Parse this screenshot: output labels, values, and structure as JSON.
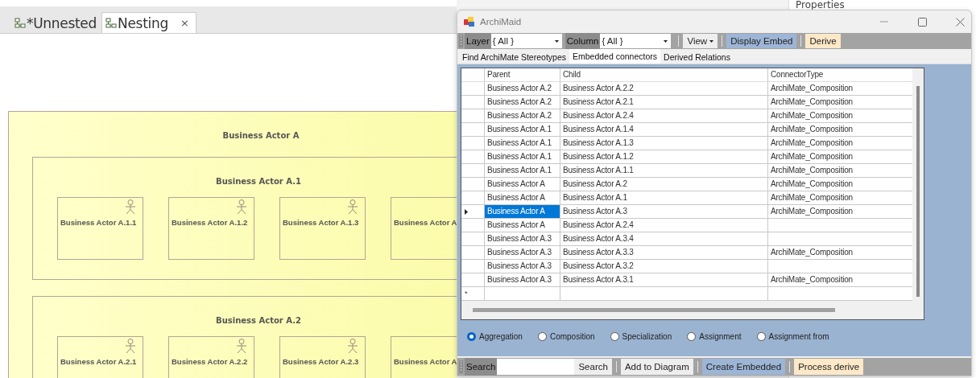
{
  "editor": {
    "tabs": [
      {
        "label": "*Unnested",
        "selected": false
      },
      {
        "label": "Nesting",
        "selected": true,
        "close": "×"
      }
    ],
    "diagram": {
      "title": "Business Actor A",
      "groups": [
        {
          "title": "Business Actor A.1",
          "actors": [
            "Business Actor A.1.1",
            "Business Actor A.1.2",
            "Business Actor A.1.3",
            "Business Actor A"
          ]
        },
        {
          "title": "Business Actor A.2",
          "actors": [
            "Business Actor A.2.1",
            "Business Actor A.2.2",
            "Business Actor A.2.3",
            "Business Actor A"
          ]
        }
      ]
    }
  },
  "properties": {
    "title": "Properties"
  },
  "window": {
    "title": "ArchiMaid",
    "toolbar": [
      {
        "kind": "label",
        "text": "Layer"
      },
      {
        "kind": "dropdown",
        "value": "{ All }"
      },
      {
        "kind": "label",
        "text": "Column"
      },
      {
        "kind": "dropdown",
        "value": "{ All }"
      },
      {
        "kind": "separator"
      },
      {
        "kind": "menu",
        "text": "View"
      },
      {
        "kind": "separator"
      },
      {
        "kind": "button",
        "text": "Display Embed",
        "color": "#9db5d6"
      },
      {
        "kind": "separator"
      },
      {
        "kind": "button",
        "text": "Derive",
        "color": "#fde8c8"
      }
    ],
    "tabs": [
      {
        "label": "Find ArchiMate Stereotypes",
        "selected": false
      },
      {
        "label": "Embedded connectors",
        "selected": true
      },
      {
        "label": "Derived Relations",
        "selected": false
      }
    ],
    "table": {
      "columns": [
        "Parent",
        "Child",
        "ConnectorType"
      ],
      "rows": [
        {
          "cells": [
            "Business Actor A.2",
            "Business Actor A.2.2",
            "ArchiMate_Composition"
          ],
          "selected": false
        },
        {
          "cells": [
            "Business Actor A.2",
            "Business Actor A.2.1",
            "ArchiMate_Composition"
          ],
          "selected": false
        },
        {
          "cells": [
            "Business Actor A.2",
            "Business Actor A.2.4",
            "ArchiMate_Composition"
          ],
          "selected": false
        },
        {
          "cells": [
            "Business Actor A.1",
            "Business Actor A.1.4",
            "ArchiMate_Composition"
          ],
          "selected": false
        },
        {
          "cells": [
            "Business Actor A.1",
            "Business Actor A.1.3",
            "ArchiMate_Composition"
          ],
          "selected": false
        },
        {
          "cells": [
            "Business Actor A.1",
            "Business Actor A.1.2",
            "ArchiMate_Composition"
          ],
          "selected": false
        },
        {
          "cells": [
            "Business Actor A.1",
            "Business Actor A.1.1",
            "ArchiMate_Composition"
          ],
          "selected": false
        },
        {
          "cells": [
            "Business Actor A",
            "Business Actor A.2",
            "ArchiMate_Composition"
          ],
          "selected": false
        },
        {
          "cells": [
            "Business Actor A",
            "Business Actor A.1",
            "ArchiMate_Composition"
          ],
          "selected": false
        },
        {
          "cells": [
            "Business Actor A",
            "Business Actor A.3",
            "ArchiMate_Composition"
          ],
          "selected": true
        },
        {
          "cells": [
            "Business Actor A",
            "Business Actor A.2.4",
            ""
          ],
          "selected": false
        },
        {
          "cells": [
            "Business Actor A.3",
            "Business Actor A.3.4",
            ""
          ],
          "selected": false
        },
        {
          "cells": [
            "Business Actor A.3",
            "Business Actor A.3.3",
            "ArchiMate_Composition"
          ],
          "selected": false
        },
        {
          "cells": [
            "Business Actor A.3",
            "Business Actor A.3.2",
            ""
          ],
          "selected": false
        },
        {
          "cells": [
            "Business Actor A.3",
            "Business Actor A.3.1",
            "ArchiMate_Composition"
          ],
          "selected": false
        }
      ],
      "new_row_marker": "*"
    },
    "radios": [
      {
        "label": "Aggregation",
        "selected": true
      },
      {
        "label": "Composition",
        "selected": false
      },
      {
        "label": "Specialization",
        "selected": false
      },
      {
        "label": "Assignment",
        "selected": false
      },
      {
        "label": "Assignment from",
        "selected": false
      }
    ],
    "bottom_toolbar": [
      {
        "kind": "label",
        "text": "Search"
      },
      {
        "kind": "input"
      },
      {
        "kind": "plain",
        "text": "Search"
      },
      {
        "kind": "separator"
      },
      {
        "kind": "plain",
        "text": "Add to Diagram"
      },
      {
        "kind": "separator"
      },
      {
        "kind": "button",
        "text": "Create Embedded",
        "color": "#9db5d6"
      },
      {
        "kind": "separator"
      },
      {
        "kind": "button",
        "text": "Process derive",
        "color": "#fde8c8"
      }
    ]
  }
}
